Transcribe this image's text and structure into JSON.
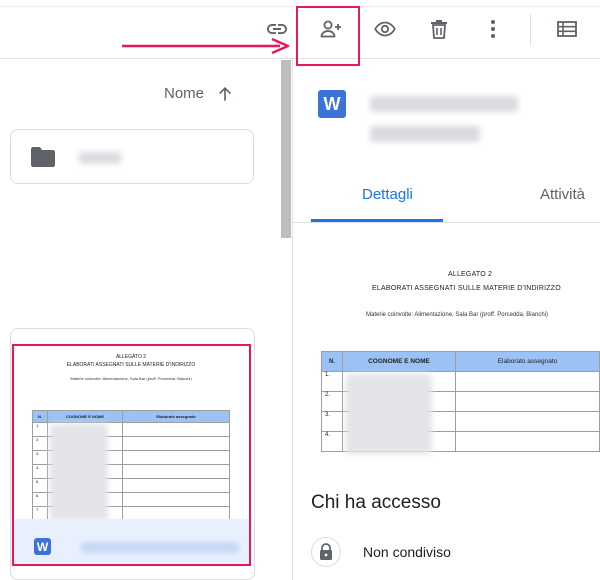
{
  "toolbar": {
    "actions": [
      {
        "name": "link-icon"
      },
      {
        "name": "add-person-icon"
      },
      {
        "name": "eye-icon"
      },
      {
        "name": "trash-icon"
      },
      {
        "name": "more-vert-icon"
      },
      {
        "name": "list-view-icon"
      }
    ]
  },
  "list": {
    "sort_label": "Nome",
    "sort_icon": "arrow-up-icon"
  },
  "file_card": {
    "doc_icon_letter": "W",
    "preview": {
      "heading_1": "ALLEGATO 2",
      "heading_2": "ELABORATI ASSEGNATI SULLE MATERIE D'INDIRIZZO",
      "subtitle": "Materie coinvolte: Alimentazione, Sala Bar (proff. Porcedda, Bianchi)",
      "col_n": "N.",
      "col_name": "COGNOME E NOME",
      "col_work": "Elaborato assegnato",
      "rows": [
        "1.",
        "2.",
        "3.",
        "4.",
        "5.",
        "6.",
        "7.",
        "8."
      ]
    }
  },
  "details": {
    "doc_icon_letter": "W",
    "tabs": [
      {
        "label": "Dettagli"
      },
      {
        "label": "Attività"
      }
    ],
    "preview": {
      "heading_1": "ALLEGATO 2",
      "heading_2": "ELABORATI ASSEGNATI SULLE MATERIE D'INDIRIZZO",
      "subtitle": "Materie coinvolte: Alimentazione, Sala Bar (proff. Porcedda, Bianchi)",
      "col_n": "N.",
      "col_name": "COGNOME E NOME",
      "col_work": "Elaborato assegnato",
      "rows": [
        "1.",
        "2.",
        "3.",
        "4."
      ]
    },
    "access_title": "Chi ha accesso",
    "access_status": "Non condiviso"
  },
  "colors": {
    "highlight": "#e8175d",
    "accent": "#1a73e8",
    "word_blue": "#3b73d8"
  }
}
